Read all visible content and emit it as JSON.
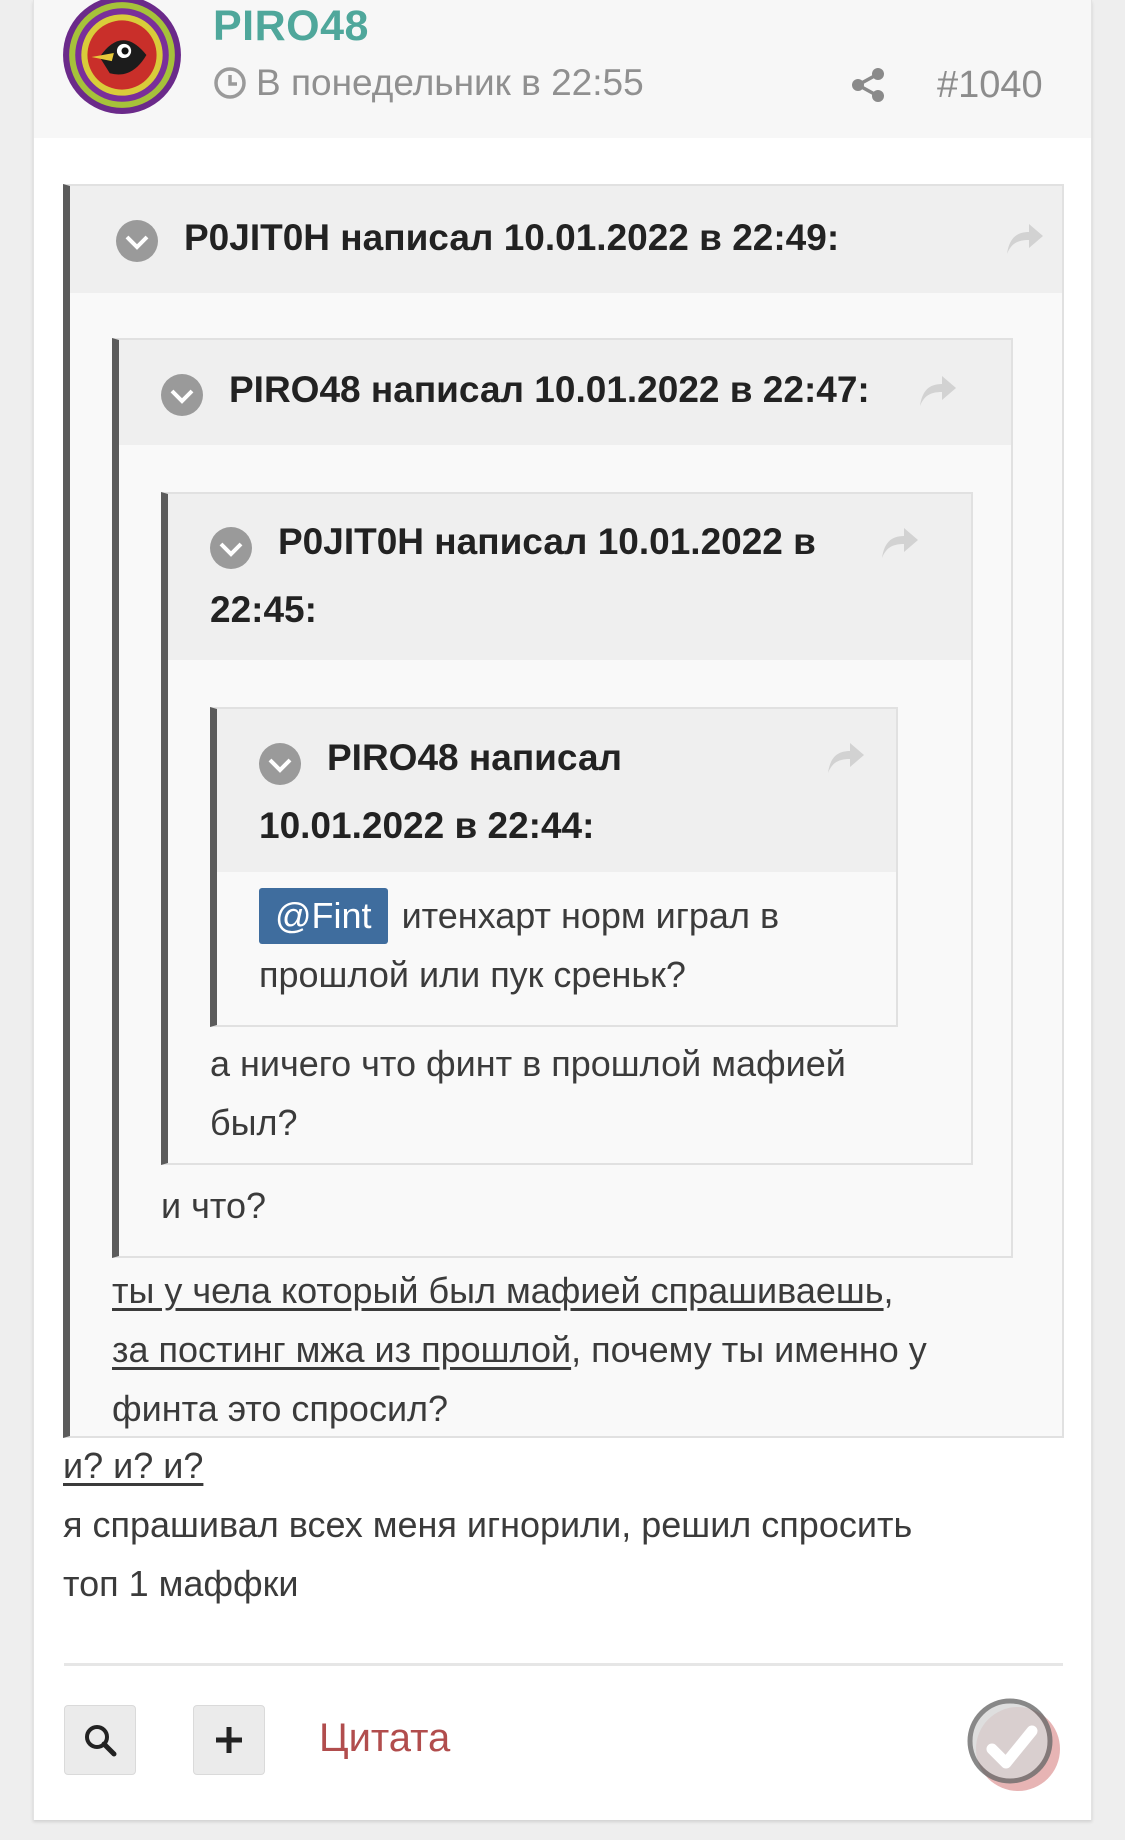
{
  "post": {
    "author": "PIRO48",
    "date": "В понедельник в 22:55",
    "number": "#1040"
  },
  "quotes": [
    {
      "author": "P0JIT0H",
      "title": "P0JIT0H написал 10.01.2022 в 22:49:"
    },
    {
      "author": "PIRO48",
      "title": "PIRO48 написал 10.01.2022 в 22:47:"
    },
    {
      "author": "P0JIT0H",
      "title_line1": "P0JIT0H написал 10.01.2022 в",
      "title_line2": "22:45:"
    },
    {
      "author": "PIRO48",
      "title_line1": "PIRO48 написал",
      "title_line2": "10.01.2022 в 22:44:",
      "mention": "@Fint",
      "text_line1": " итенхарт норм играл в",
      "text_line2": "прошлой или пук среньк?"
    }
  ],
  "replies": {
    "level3_line1": "а ничего что финт в прошлой мафией",
    "level3_line2": "был?",
    "level2": "и что?",
    "level1_underlined_1": "ты у чела который был мафией спрашиваешь",
    "level1_after_1": ",",
    "level1_underlined_2": "за постинг мжа из прошлой",
    "level1_after_2": ", почему ты именно у",
    "level1_line3": "финта это спросил?",
    "main_underlined": "и? и? и?",
    "main_line2": "я спрашивал всех меня игнорили, решил спросить",
    "main_line3": "топ 1 маффки"
  },
  "footer": {
    "quote_label": "Цитата"
  },
  "icons": [
    "avatar-image",
    "clock-icon",
    "share-icon",
    "chevron-down-icon",
    "reply-arrow-icon",
    "search-icon",
    "plus-icon",
    "like-icon"
  ],
  "colors": {
    "author": "#4fa79b",
    "mention_bg": "#3f6d9e",
    "quote_link": "#b14d4d",
    "quote_border": "#5b5b5b"
  }
}
